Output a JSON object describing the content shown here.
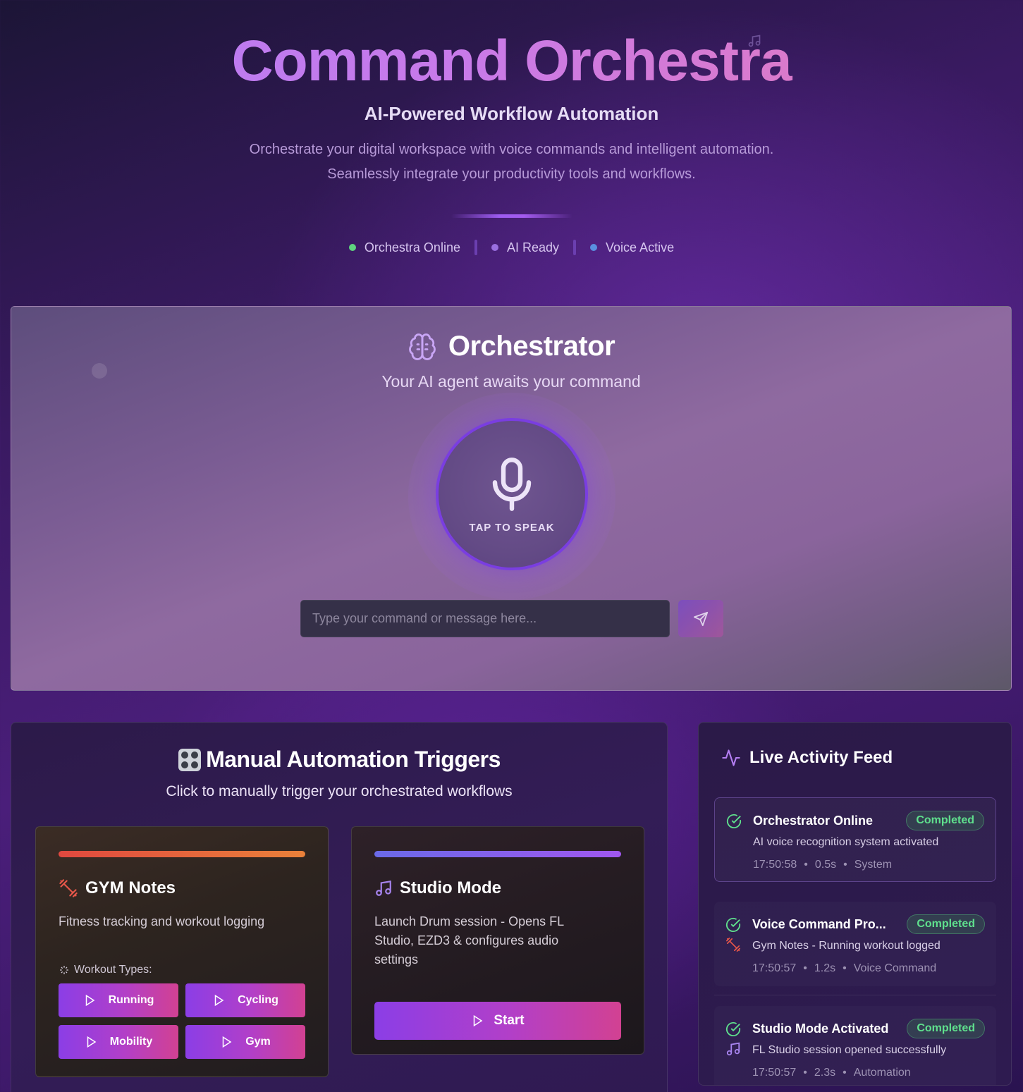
{
  "header": {
    "title": "Command Orchestra",
    "subtitle": "AI-Powered Workflow Automation",
    "description_line1": "Orchestrate your digital workspace with voice commands and intelligent automation.",
    "description_line2": "Seamlessly integrate your productivity tools and workflows.",
    "statuses": [
      {
        "label": "Orchestra Online",
        "color": "#5fd47f"
      },
      {
        "label": "AI Ready",
        "color": "#9a6fe0"
      },
      {
        "label": "Voice Active",
        "color": "#5a8fe0"
      }
    ]
  },
  "orchestrator": {
    "title": "Orchestrator",
    "subtitle": "Your AI agent awaits your command",
    "mic_label": "TAP TO SPEAK",
    "input_placeholder": "Type your command or message here...",
    "icon": "brain-icon",
    "send_icon": "send-icon"
  },
  "triggers": {
    "title": "Manual Automation Triggers",
    "subtitle": "Click to manually trigger your orchestrated workflows",
    "icon": "control-knobs-icon",
    "gym": {
      "title": "GYM Notes",
      "description": "Fitness tracking and workout logging",
      "workout_types_label": "Workout Types:",
      "accent": "#e0583f",
      "buttons": [
        "Running",
        "Cycling",
        "Mobility",
        "Gym"
      ]
    },
    "studio": {
      "title": "Studio Mode",
      "description": "Launch Drum session - Opens FL Studio, EZD3 & configures audio settings",
      "start_label": "Start",
      "accent": "#8a5cf0"
    }
  },
  "feed": {
    "title": "Live Activity Feed",
    "items": [
      {
        "title": "Orchestrator Online",
        "status": "Completed",
        "description": "AI voice recognition system activated",
        "time": "17:50:58",
        "duration": "0.5s",
        "source": "System"
      },
      {
        "title": "Voice Command Pro...",
        "status": "Completed",
        "description": "Gym Notes - Running workout logged",
        "time": "17:50:57",
        "duration": "1.2s",
        "source": "Voice Command"
      },
      {
        "title": "Studio Mode Activated",
        "status": "Completed",
        "description": "FL Studio session opened successfully",
        "time": "17:50:57",
        "duration": "2.3s",
        "source": "Automation"
      }
    ],
    "separator": "•"
  }
}
